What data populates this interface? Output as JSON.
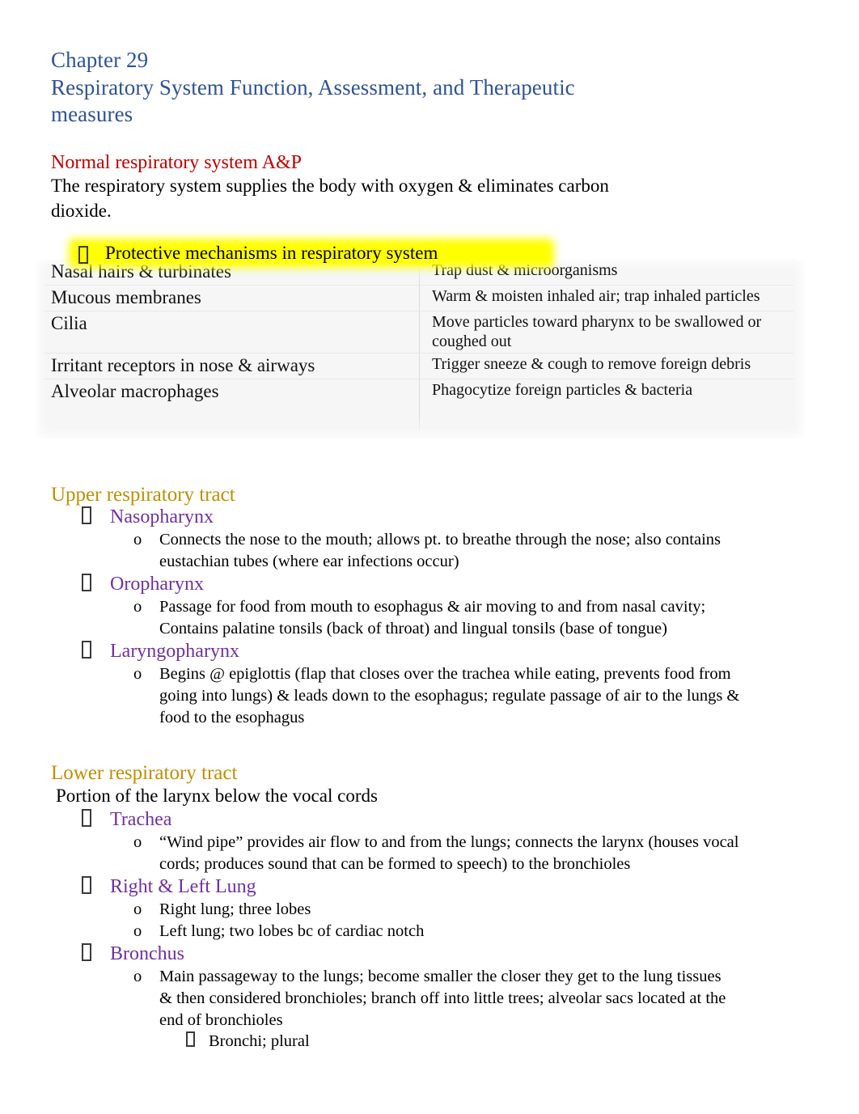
{
  "document": {
    "title_lines": [
      "Chapter 29",
      "Respiratory System Function, Assessment, and Therapeutic",
      "measures"
    ],
    "title_color": "#2e5395"
  },
  "section_normal": {
    "heading": "Normal respiratory system A&P",
    "heading_color": "#c00000",
    "intro": "The respiratory system supplies the body with oxygen & eliminates carbon dioxide.",
    "highlighted_bullet": "Protective mechanisms in respiratory system",
    "highlight_color": "#ffff00",
    "table": {
      "rows": [
        {
          "mechanism": "Nasal hairs & turbinates",
          "function": "Trap dust & microorganisms"
        },
        {
          "mechanism": "Mucous membranes",
          "function": "Warm & moisten inhaled air; trap inhaled particles"
        },
        {
          "mechanism": "Cilia",
          "function": "Move particles toward pharynx to be swallowed or coughed out"
        },
        {
          "mechanism": "Irritant receptors in nose & airways",
          "function": "Trigger sneeze & cough to remove foreign debris"
        },
        {
          "mechanism": "Alveolar macrophages",
          "function": "Phagocytize foreign particles & bacteria"
        }
      ]
    }
  },
  "section_upper": {
    "heading": "Upper respiratory tract",
    "heading_color": "#bf8f00",
    "subheading_color": "#7030a0",
    "items": [
      {
        "label": "Nasopharynx",
        "details": [
          "Connects the nose to the mouth; allows pt. to breathe through the nose; also contains eustachian tubes (where ear infections occur)"
        ]
      },
      {
        "label": "Oropharynx",
        "details": [
          "Passage for food from mouth to esophagus & air moving to and from nasal cavity; Contains palatine tonsils (back of throat) and lingual tonsils (base of tongue)"
        ]
      },
      {
        "label": "Laryngopharynx",
        "details": [
          "Begins @ epiglottis (flap that closes over the trachea while eating, prevents food from going into lungs) & leads down to the esophagus; regulate passage of air to the lungs & food to the esophagus"
        ]
      }
    ]
  },
  "section_lower": {
    "heading": "Lower respiratory tract",
    "heading_color": "#bf8f00",
    "lead_line": "Portion of the larynx below the vocal cords",
    "items": [
      {
        "label": "Trachea",
        "details": [
          "“Wind pipe” provides air flow to and from the lungs; connects the larynx (houses vocal cords; produces sound that can be formed to speech) to the bronchioles"
        ],
        "subdetails": []
      },
      {
        "label": "Right & Left Lung",
        "details": [
          "Right lung; three lobes",
          "Left lung; two lobes bc of cardiac notch"
        ],
        "subdetails": []
      },
      {
        "label": "Bronchus",
        "details": [
          "Main passageway to the lungs; become smaller the closer they get to the lung tissues & then considered bronchioles; branch off into little trees; alveolar sacs located at the end of bronchioles"
        ],
        "subdetails": [
          "Bronchi; plural"
        ]
      }
    ]
  }
}
